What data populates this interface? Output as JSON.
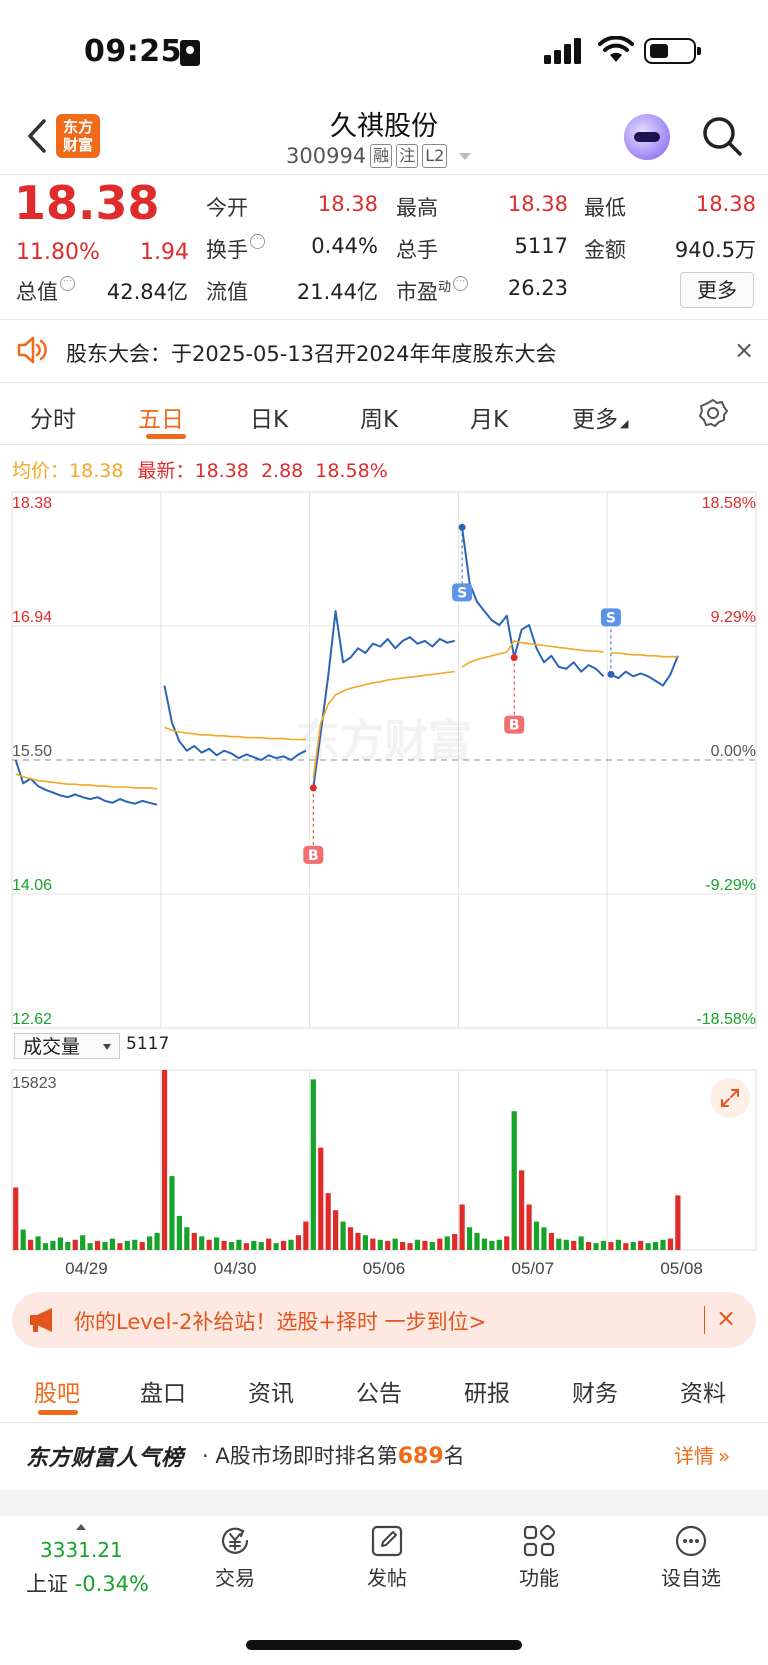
{
  "status_bar": {
    "time": "09:25"
  },
  "header": {
    "logo_text": "东方财富",
    "stock_name": "久祺股份",
    "stock_code": "300994",
    "tags": [
      "融",
      "注",
      "L2"
    ]
  },
  "quote": {
    "price": "18.38",
    "change_pct": "11.80%",
    "change_amt": "1.94",
    "fields": [
      {
        "label": "今开",
        "value": "18.38",
        "color": "red"
      },
      {
        "label": "最高",
        "value": "18.38",
        "color": "red"
      },
      {
        "label": "最低",
        "value": "18.38",
        "color": "red"
      },
      {
        "label": "换手",
        "value": "0.44%",
        "color": "black",
        "info": true
      },
      {
        "label": "总手",
        "value": "5117",
        "color": "black"
      },
      {
        "label": "金额",
        "value": "940.5万",
        "color": "black"
      },
      {
        "label": "总值",
        "value": "42.84亿",
        "color": "black",
        "info": true
      },
      {
        "label": "流值",
        "value": "21.44亿",
        "color": "black"
      },
      {
        "label": "市盈",
        "sup": "动",
        "value": "26.23",
        "color": "black",
        "info": true
      }
    ],
    "more_label": "更多"
  },
  "notice": {
    "text": "股东大会：于2025-05-13召开2024年年度股东大会",
    "close": "×"
  },
  "chart_tabs": [
    "分时",
    "五日",
    "日K",
    "周K",
    "月K",
    "更多"
  ],
  "active_chart_tab": "五日",
  "legend": {
    "avg_label": "均价：",
    "avg_value": "18.38",
    "latest_label": "最新：",
    "latest_value": "18.38",
    "latest_change": "2.88",
    "latest_pct": "18.58%"
  },
  "colors": {
    "up": "#e02b2b",
    "down": "#17a32a",
    "price_line": "#2a64b8",
    "avg_line": "#f5a623",
    "accent": "#f06a1a"
  },
  "chart_data": {
    "type": "line",
    "days": [
      "04/29",
      "04/30",
      "05/06",
      "05/07",
      "05/08"
    ],
    "y_ticks_left": [
      "18.38",
      "16.94",
      "15.50",
      "14.06",
      "12.62"
    ],
    "y_ticks_right": [
      "18.58%",
      "9.29%",
      "0.00%",
      "-9.29%",
      "-18.58%"
    ],
    "ylim": [
      12.62,
      18.38
    ],
    "prev_close": 15.5,
    "series": [
      {
        "role": "price",
        "values": [
          15.5,
          15.25,
          15.3,
          15.22,
          15.18,
          15.15,
          15.12,
          15.1,
          15.13,
          15.1,
          15.08,
          15.1,
          15.06,
          15.04,
          15.08,
          15.05,
          15.03,
          15.06,
          15.04,
          15.02,
          16.3,
          15.9,
          15.7,
          15.6,
          15.65,
          15.58,
          15.62,
          15.55,
          15.6,
          15.57,
          15.52,
          15.56,
          15.53,
          15.5,
          15.55,
          15.52,
          15.54,
          15.5,
          15.56,
          15.6,
          15.2,
          15.8,
          16.4,
          17.1,
          16.55,
          16.6,
          16.7,
          16.65,
          16.75,
          16.72,
          16.8,
          16.7,
          16.78,
          16.82,
          16.75,
          16.78,
          16.72,
          16.8,
          16.76,
          16.78,
          18.0,
          17.4,
          17.2,
          17.1,
          17.0,
          16.95,
          17.05,
          16.6,
          16.9,
          16.95,
          16.7,
          16.55,
          16.62,
          16.5,
          16.48,
          16.55,
          16.45,
          16.52,
          16.48,
          16.4,
          16.42,
          16.38,
          16.45,
          16.4,
          16.43,
          16.4,
          16.35,
          16.3,
          16.42,
          16.62
        ]
      },
      {
        "role": "average",
        "values": [
          15.35,
          15.32,
          15.3,
          15.28,
          15.27,
          15.26,
          15.25,
          15.24,
          15.24,
          15.23,
          15.23,
          15.22,
          15.22,
          15.21,
          15.21,
          15.21,
          15.2,
          15.2,
          15.2,
          15.19,
          15.85,
          15.82,
          15.8,
          15.79,
          15.78,
          15.77,
          15.77,
          15.76,
          15.76,
          15.75,
          15.75,
          15.74,
          15.74,
          15.74,
          15.73,
          15.73,
          15.73,
          15.72,
          15.72,
          15.72,
          15.3,
          15.9,
          16.1,
          16.2,
          16.24,
          16.27,
          16.29,
          16.31,
          16.33,
          16.34,
          16.36,
          16.37,
          16.38,
          16.39,
          16.4,
          16.41,
          16.42,
          16.43,
          16.44,
          16.45,
          16.5,
          16.55,
          16.58,
          16.6,
          16.62,
          16.64,
          16.66,
          16.78,
          16.76,
          16.75,
          16.74,
          16.73,
          16.72,
          16.71,
          16.7,
          16.69,
          16.68,
          16.67,
          16.67,
          16.66,
          16.65,
          16.65,
          16.64,
          16.63,
          16.63,
          16.62,
          16.62,
          16.61,
          16.61,
          16.61
        ]
      }
    ],
    "markers": [
      {
        "label": "B",
        "type": "buy",
        "index": 40
      },
      {
        "label": "S",
        "type": "sell",
        "index": 60
      },
      {
        "label": "B",
        "type": "buy",
        "index": 67
      },
      {
        "label": "S",
        "type": "sell",
        "index": 80
      }
    ],
    "watermark": "东方财富"
  },
  "volume": {
    "selector": "成交量",
    "current": "5117",
    "max_label": "15823",
    "max": 15823,
    "values": [
      5500,
      1800,
      900,
      1200,
      600,
      800,
      1100,
      700,
      900,
      1300,
      600,
      800,
      700,
      1000,
      600,
      800,
      900,
      700,
      1200,
      1500,
      15823,
      6500,
      3000,
      2000,
      1500,
      1200,
      900,
      1100,
      800,
      700,
      900,
      600,
      800,
      700,
      1000,
      600,
      800,
      900,
      1300,
      2500,
      15000,
      9000,
      5000,
      3500,
      2500,
      2000,
      1500,
      1300,
      1000,
      900,
      800,
      1000,
      700,
      600,
      900,
      800,
      700,
      1000,
      1200,
      1400,
      4000,
      2000,
      1500,
      1000,
      800,
      900,
      1200,
      12200,
      7000,
      4000,
      2500,
      2000,
      1500,
      1000,
      900,
      800,
      1200,
      700,
      600,
      800,
      700,
      900,
      600,
      700,
      800,
      600,
      700,
      900,
      1000,
      4800
    ]
  },
  "banner": {
    "text": "你的Level-2补给站！选股+择时 一步到位>",
    "close": "×"
  },
  "bottom_tabs": [
    "股吧",
    "盘口",
    "资讯",
    "公告",
    "研报",
    "财务",
    "资料"
  ],
  "active_bottom_tab": "股吧",
  "popularity": {
    "logo": "东方财富人气榜",
    "text_prefix": "· A股市场即时排名第",
    "rank": "689",
    "text_suffix": "名",
    "detail": "详情"
  },
  "footer": {
    "index_value": "3331.21",
    "index_name": "上证",
    "index_change": "-0.34%",
    "items": [
      {
        "label": "交易",
        "icon": "yen-refresh-icon"
      },
      {
        "label": "发帖",
        "icon": "edit-icon"
      },
      {
        "label": "功能",
        "icon": "grid-icon"
      },
      {
        "label": "设自选",
        "icon": "more-dots-icon"
      }
    ]
  }
}
